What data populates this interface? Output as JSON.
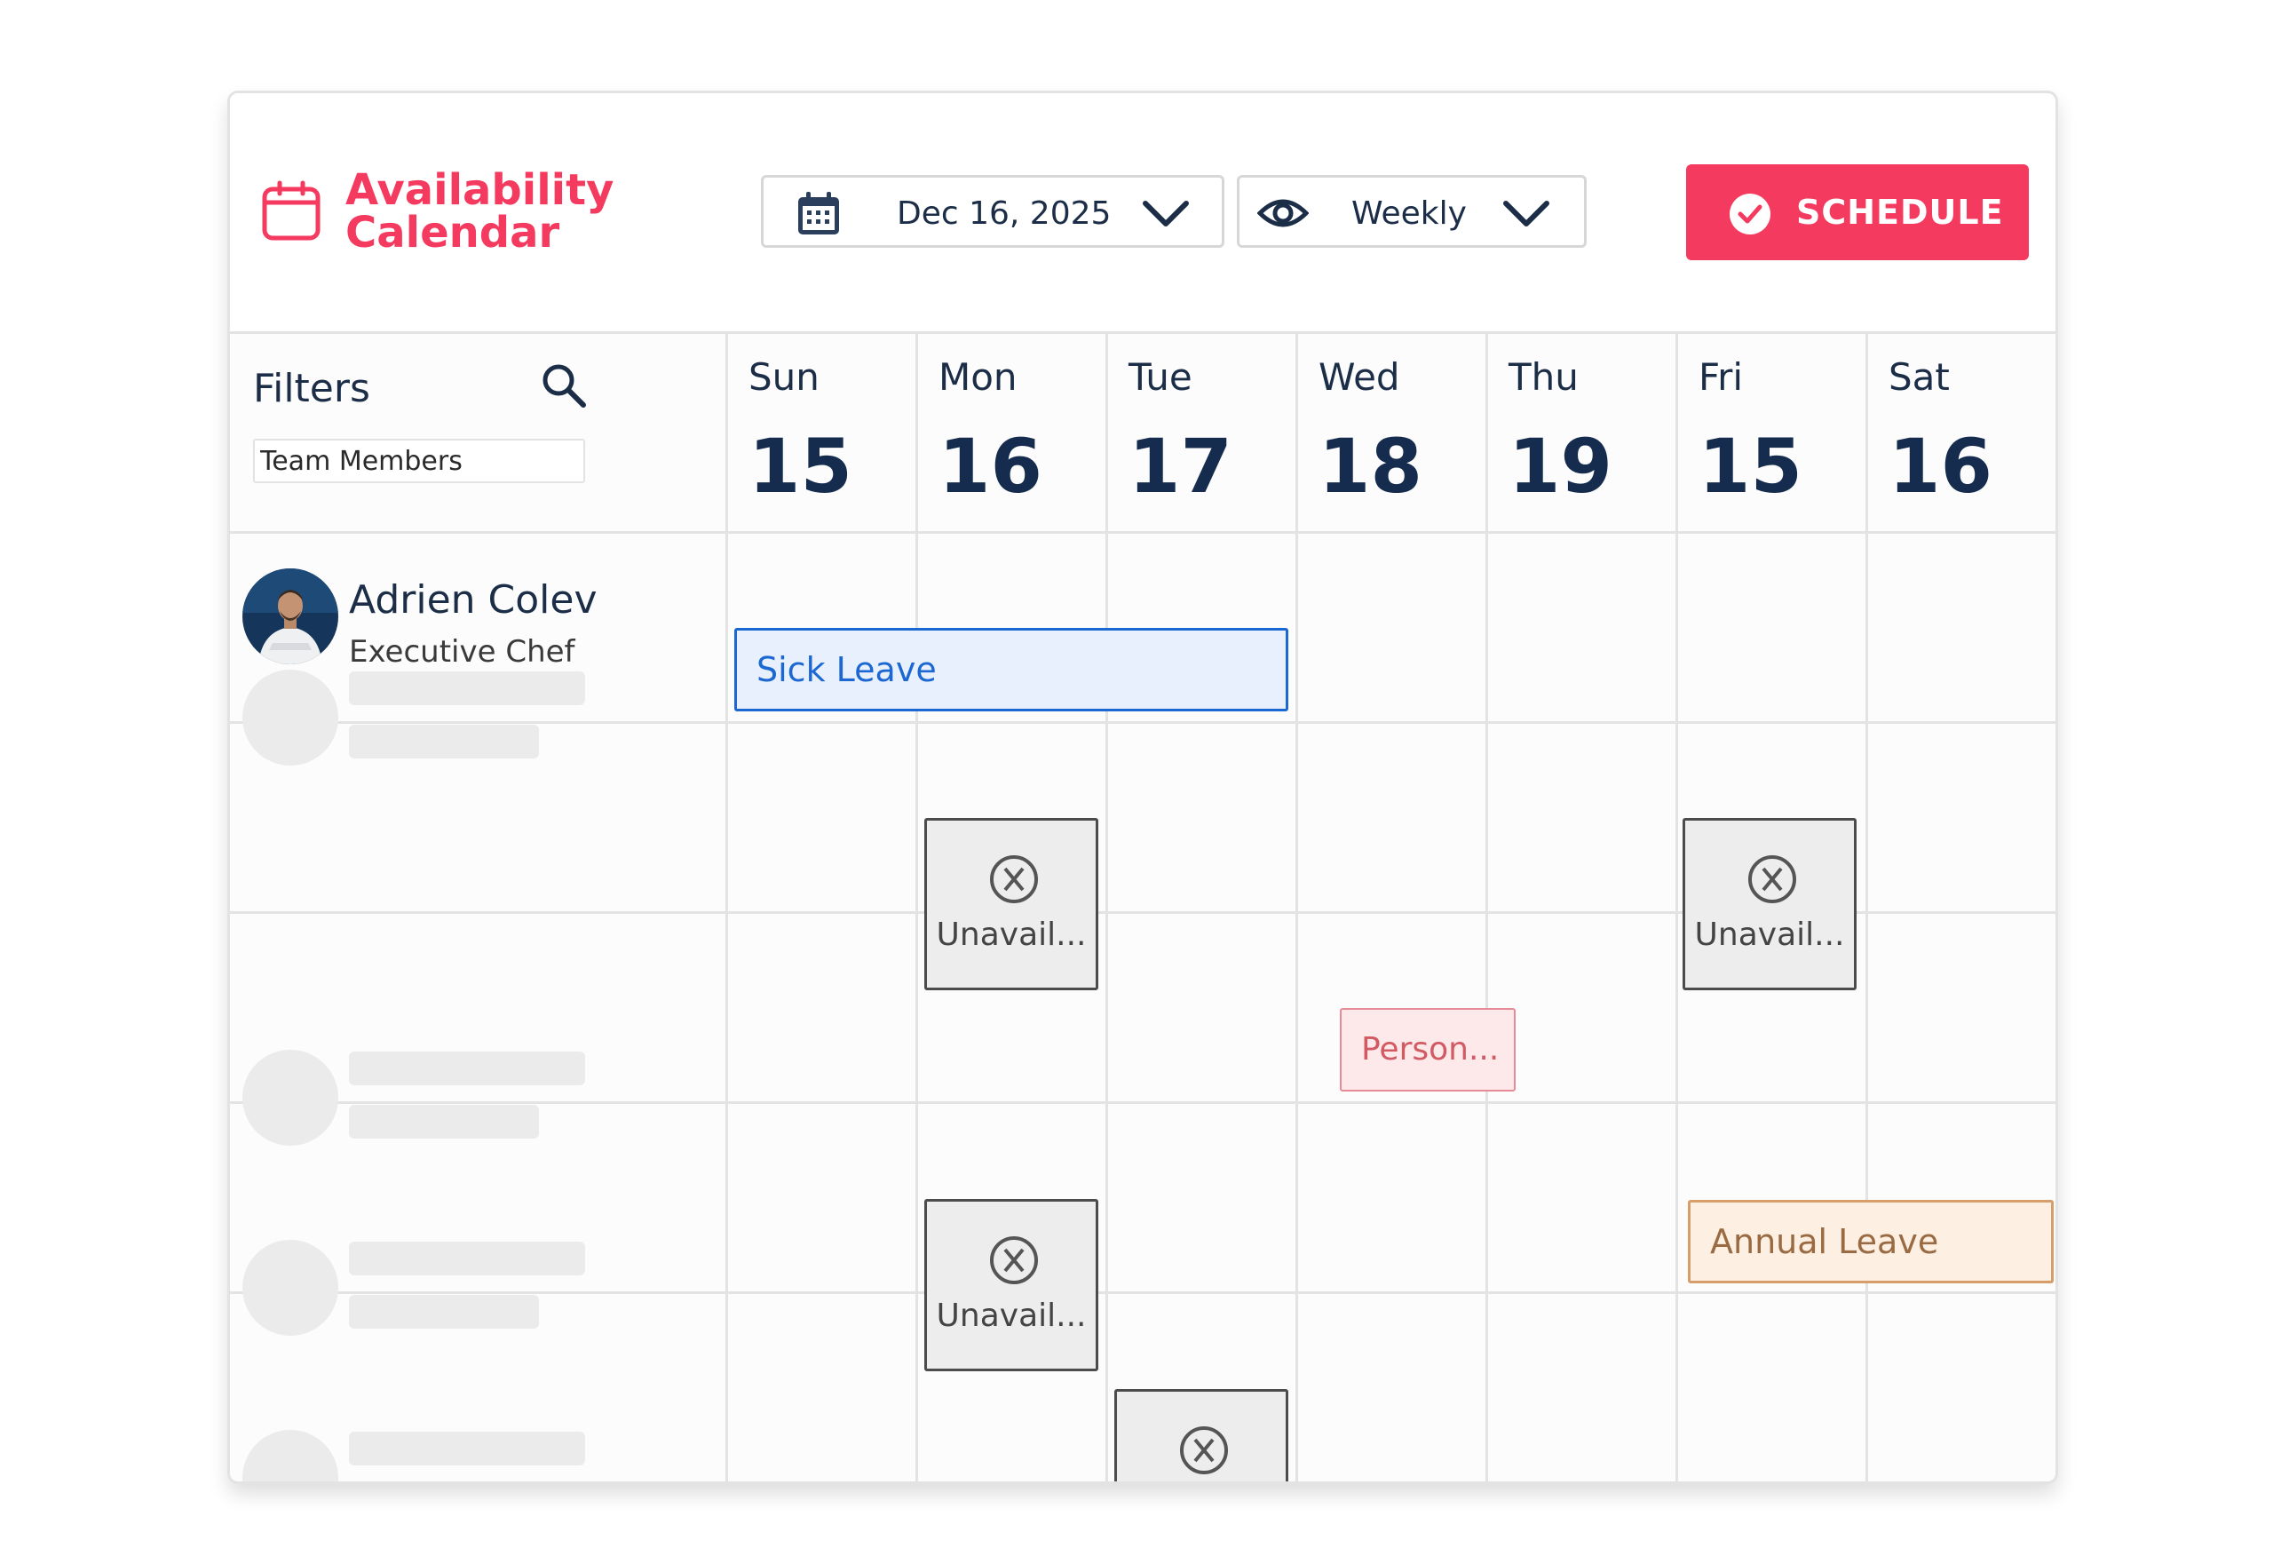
{
  "app": {
    "title_line1": "Availability",
    "title_line2": "Calendar",
    "accent_color": "#f43a5e"
  },
  "toolbar": {
    "date_value": "Dec 16, 2025",
    "view_value": "Weekly",
    "schedule_label": "SCHEDULE"
  },
  "filters": {
    "label": "Filters",
    "input_value": "Team Members"
  },
  "days": [
    {
      "name": "Sun",
      "num": "15"
    },
    {
      "name": "Mon",
      "num": "16"
    },
    {
      "name": "Tue",
      "num": "17"
    },
    {
      "name": "Wed",
      "num": "18"
    },
    {
      "name": "Thu",
      "num": "19"
    },
    {
      "name": "Fri",
      "num": "15"
    },
    {
      "name": "Sat",
      "num": "16"
    }
  ],
  "member": {
    "name": "Adrien Colev",
    "role": "Executive Chef"
  },
  "events": {
    "sick": "Sick Leave",
    "personal": "Person...",
    "annual": "Annual Leave",
    "unavailable": "Unavail..."
  }
}
